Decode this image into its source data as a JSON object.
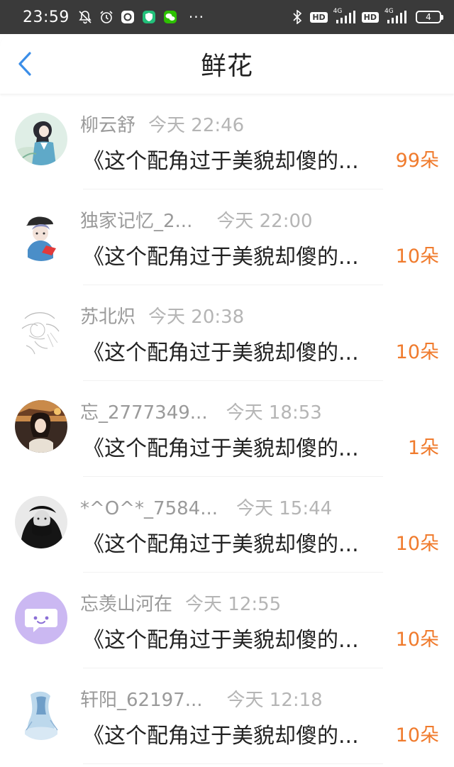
{
  "status_bar": {
    "time": "23:59",
    "dots": "···",
    "hd1": "HD",
    "net1": "4G",
    "hd2": "HD",
    "net2": "4G",
    "battery": "4",
    "icons": [
      "bell-off-icon",
      "alarm-icon",
      "app-icon",
      "shield-icon",
      "wechat-icon",
      "bluetooth-icon",
      "signal-icon"
    ]
  },
  "header": {
    "title": "鲜花",
    "back_icon": "chevron-left-icon"
  },
  "colors": {
    "accent_blue": "#3b8ee8",
    "flower_orange": "#f07b2d",
    "meta_gray": "#a8a8a8"
  },
  "list": [
    {
      "name": "柳云舒",
      "time": "今天 22:46",
      "message": "《这个配角过于美貌却傻的...",
      "flowers": "99朵"
    },
    {
      "name": "独家记忆_2...",
      "time": "今天 22:00",
      "message": "《这个配角过于美貌却傻的...",
      "flowers": "10朵"
    },
    {
      "name": "苏北炽",
      "time": "今天 20:38",
      "message": "《这个配角过于美貌却傻的...",
      "flowers": "10朵"
    },
    {
      "name": "忘_2777349...",
      "time": "今天 18:53",
      "message": "《这个配角过于美貌却傻的...",
      "flowers": "1朵"
    },
    {
      "name": "*^O^*_7584...",
      "time": "今天 15:44",
      "message": "《这个配角过于美貌却傻的...",
      "flowers": "10朵"
    },
    {
      "name": "忘羡山河在",
      "time": "今天 12:55",
      "message": "《这个配角过于美貌却傻的...",
      "flowers": "10朵"
    },
    {
      "name": "轩阳_62197...",
      "time": "今天 12:18",
      "message": "《这个配角过于美貌却傻的...",
      "flowers": "10朵"
    }
  ]
}
